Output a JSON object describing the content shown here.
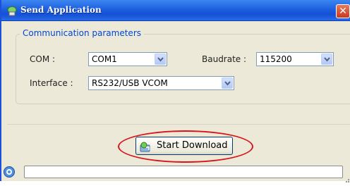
{
  "window": {
    "title": "Send Application",
    "close_glyph": "✕"
  },
  "group": {
    "title": "Communication parameters"
  },
  "com": {
    "label": "COM :",
    "value": "COM1"
  },
  "baudrate": {
    "label": "Baudrate :",
    "value": "115200"
  },
  "interface": {
    "label": "Interface :",
    "value": "RS232/USB VCOM"
  },
  "actions": {
    "start_download_label": "Start Download"
  },
  "status": {
    "text": ""
  },
  "icons": {
    "title": "app-icon",
    "download": "download-icon",
    "status": "info-icon",
    "grip": "resize-grip-icon"
  },
  "colors": {
    "titlebar": "#1e5fe0",
    "groupbox_title": "#0046d5",
    "annotation_ellipse": "#d8151b",
    "face": "#ECE9D8"
  }
}
